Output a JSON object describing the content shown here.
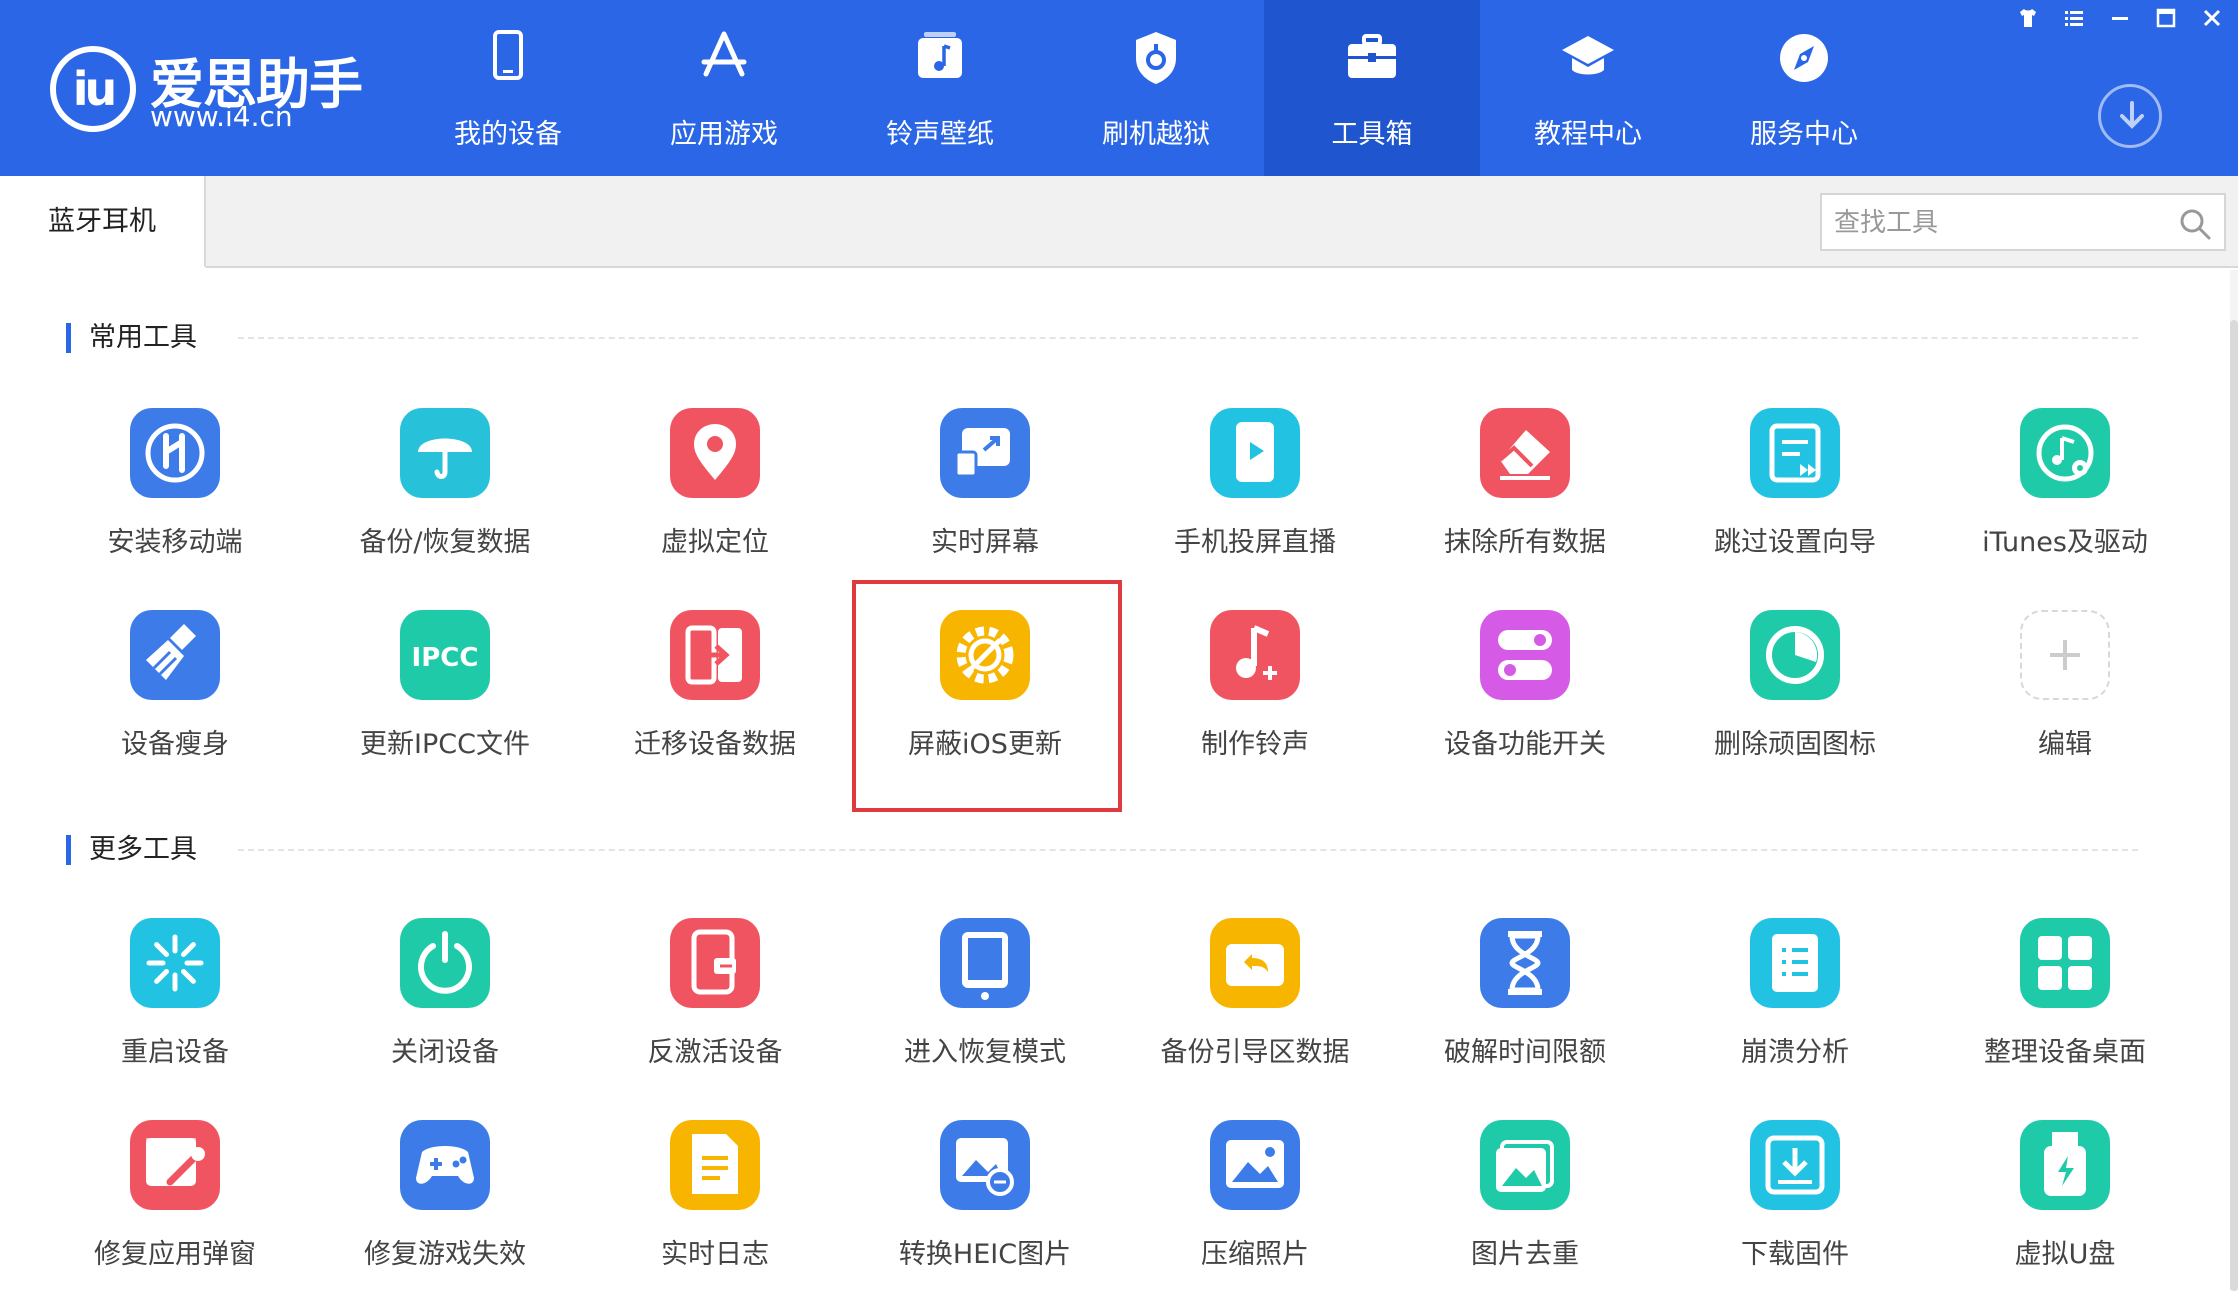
{
  "app": {
    "logo_glyph": "iu",
    "name": "爱思助手",
    "url": "www.i4.cn"
  },
  "nav": {
    "items": [
      {
        "label": "我的设备",
        "icon": "phone-icon"
      },
      {
        "label": "应用游戏",
        "icon": "app-store-icon"
      },
      {
        "label": "铃声壁纸",
        "icon": "ringtone-icon"
      },
      {
        "label": "刷机越狱",
        "icon": "flash-shield-icon"
      },
      {
        "label": "工具箱",
        "icon": "toolbox-icon",
        "active": true
      },
      {
        "label": "教程中心",
        "icon": "graduation-cap-icon"
      },
      {
        "label": "服务中心",
        "icon": "compass-icon"
      }
    ]
  },
  "tabbar": {
    "tab_label": "蓝牙耳机",
    "search_placeholder": "查找工具"
  },
  "sections": {
    "common": {
      "title": "常用工具",
      "tools": [
        {
          "label": "安装移动端",
          "icon": "install-mobile-icon",
          "color": "#3d7ce8"
        },
        {
          "label": "备份/恢复数据",
          "icon": "umbrella-icon",
          "color": "#27c1da"
        },
        {
          "label": "虚拟定位",
          "icon": "location-pin-icon",
          "color": "#ef5460"
        },
        {
          "label": "实时屏幕",
          "icon": "screen-share-icon",
          "color": "#3d7ce8"
        },
        {
          "label": "手机投屏直播",
          "icon": "phone-cast-icon",
          "color": "#22c3e2"
        },
        {
          "label": "抹除所有数据",
          "icon": "eraser-icon",
          "color": "#ef5460"
        },
        {
          "label": "跳过设置向导",
          "icon": "skip-setup-icon",
          "color": "#22c3e2"
        },
        {
          "label": "iTunes及驱动",
          "icon": "music-gear-icon",
          "color": "#1fcaa8"
        },
        {
          "label": "设备瘦身",
          "icon": "broom-icon",
          "color": "#3d7ce8"
        },
        {
          "label": "更新IPCC文件",
          "icon": "ipcc-icon",
          "color": "#1fcaa8",
          "text": "IPCC"
        },
        {
          "label": "迁移设备数据",
          "icon": "migrate-icon",
          "color": "#ef5460"
        },
        {
          "label": "屏蔽iOS更新",
          "icon": "block-update-gear-icon",
          "color": "#f7b500"
        },
        {
          "label": "制作铃声",
          "icon": "music-note-plus-icon",
          "color": "#ef5460"
        },
        {
          "label": "设备功能开关",
          "icon": "toggle-switch-icon",
          "color": "#d55be6"
        },
        {
          "label": "删除顽固图标",
          "icon": "pie-clock-icon",
          "color": "#1fcaa8"
        },
        {
          "label": "编辑",
          "icon": "plus-icon",
          "color": "#d0d0d0"
        }
      ]
    },
    "more": {
      "title": "更多工具",
      "tools": [
        {
          "label": "重启设备",
          "icon": "restart-spark-icon",
          "color": "#22c3e2"
        },
        {
          "label": "关闭设备",
          "icon": "power-icon",
          "color": "#1fcaa8"
        },
        {
          "label": "反激活设备",
          "icon": "deactivate-icon",
          "color": "#ef5460"
        },
        {
          "label": "进入恢复模式",
          "icon": "tablet-recovery-icon",
          "color": "#3d7ce8"
        },
        {
          "label": "备份引导区数据",
          "icon": "backup-boot-icon",
          "color": "#f7b500"
        },
        {
          "label": "破解时间限额",
          "icon": "hourglass-icon",
          "color": "#3d7ce8"
        },
        {
          "label": "崩溃分析",
          "icon": "clipboard-list-icon",
          "color": "#22c3e2"
        },
        {
          "label": "整理设备桌面",
          "icon": "grid-icon",
          "color": "#1fcaa8"
        },
        {
          "label": "修复应用弹窗",
          "icon": "repair-window-icon",
          "color": "#ef5460"
        },
        {
          "label": "修复游戏失效",
          "icon": "gamepad-icon",
          "color": "#3d7ce8"
        },
        {
          "label": "实时日志",
          "icon": "document-lines-icon",
          "color": "#f7b500"
        },
        {
          "label": "转换HEIC图片",
          "icon": "convert-image-icon",
          "color": "#3d7ce8"
        },
        {
          "label": "压缩照片",
          "icon": "image-compress-icon",
          "color": "#3d7ce8"
        },
        {
          "label": "图片去重",
          "icon": "image-dedupe-icon",
          "color": "#1fcaa8"
        },
        {
          "label": "下载固件",
          "icon": "download-firmware-icon",
          "color": "#22c3e2"
        },
        {
          "label": "虚拟U盘",
          "icon": "usb-drive-icon",
          "color": "#1fcaa8"
        }
      ]
    }
  }
}
